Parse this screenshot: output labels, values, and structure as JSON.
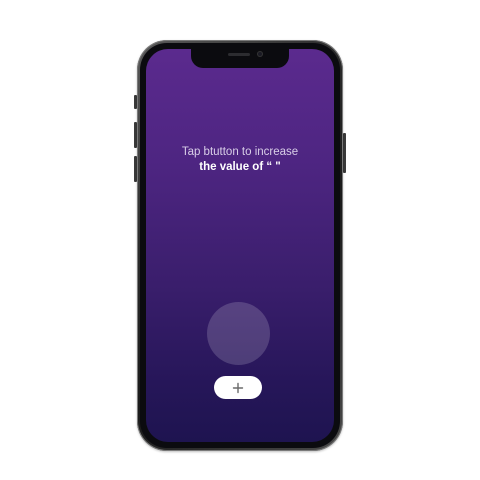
{
  "screen": {
    "instruction_line1": "Tap btutton to increase",
    "instruction_line2": "the value of “ \""
  },
  "controls": {
    "increment_icon": "plus-icon"
  },
  "colors": {
    "screen_gradient_top": "#5b2a8e",
    "screen_gradient_bottom": "#1e1450",
    "button_bg": "#ffffff",
    "frame": "#2a2a2a"
  }
}
